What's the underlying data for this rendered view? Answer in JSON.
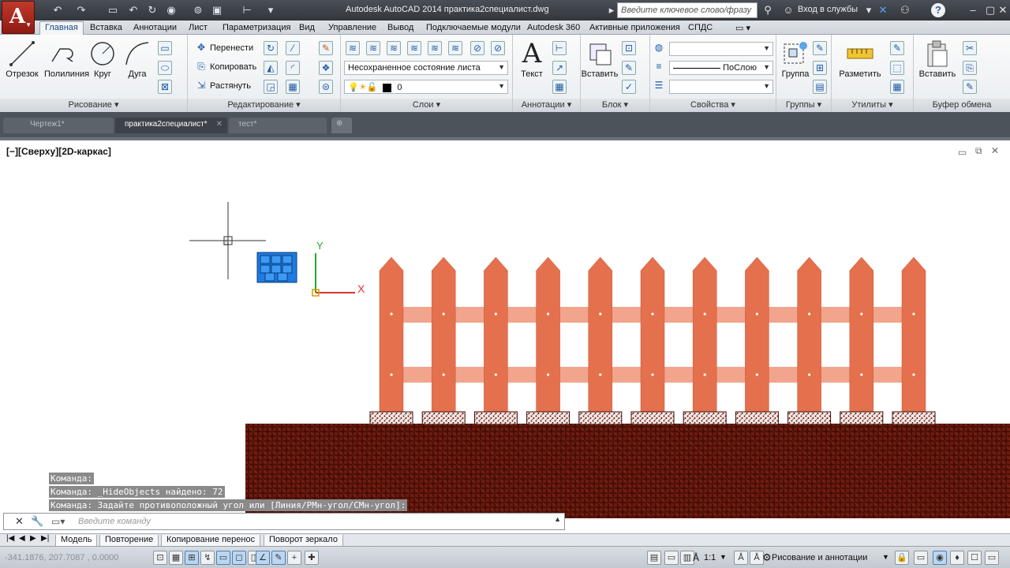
{
  "titlebar": {
    "app_logo": "A",
    "title": "Autodesk AutoCAD 2014     практика2специалист.dwg",
    "search_placeholder": "Введите ключевое слово/фразу",
    "login_label": "Вход в службы"
  },
  "ribbon_tabs": [
    "Главная",
    "Вставка",
    "Аннотации",
    "Лист",
    "Параметризация",
    "Вид",
    "Управление",
    "Вывод",
    "Подключаемые модули",
    "Autodesk 360",
    "Активные приложения",
    "СПДС"
  ],
  "ribbon": {
    "draw": {
      "title": "Рисование",
      "line": "Отрезок",
      "polyline": "Полилиния",
      "circle": "Круг",
      "arc": "Дуга"
    },
    "modify": {
      "title": "Редактирование",
      "move": "Перенести",
      "copy": "Копировать",
      "stretch": "Растянуть"
    },
    "layers": {
      "title": "Слои",
      "layer_state": "Несохраненное состояние листа",
      "current_layer": "0"
    },
    "annotations": {
      "title": "Аннотации",
      "text": "Текст"
    },
    "block": {
      "title": "Блок",
      "insert": "Вставить"
    },
    "properties": {
      "title": "Свойства",
      "lineweight": "ПоСлою"
    },
    "groups": {
      "title": "Группы",
      "group": "Группа"
    },
    "utilities": {
      "title": "Утилиты",
      "measure": "Разметить"
    },
    "clipboard": {
      "title": "Буфер обмена",
      "paste": "Вставить"
    }
  },
  "doc_tabs": [
    {
      "label": "Чертеж1*",
      "active": false
    },
    {
      "label": "практика2специалист*",
      "active": true
    },
    {
      "label": "тест*",
      "active": false
    }
  ],
  "viewport": {
    "label": "[−][Сверху][2D-каркас]",
    "ucs_x": "X",
    "ucs_y": "Y",
    "fence_pickets": 11,
    "colors": {
      "picket": "#e5704d",
      "rail": "#f1a58c",
      "ground": "#6b1a0e",
      "selection": "#1e7be0"
    }
  },
  "command": {
    "history": [
      "Команда:",
      "Команда: _HideObjects найдено: 72",
      "Команда: Задайте противоположный угол или [Линия/РМн-угол/СМн-угол]:"
    ],
    "input_placeholder": "Введите команду"
  },
  "layout_tabs": [
    "Модель",
    "Повторение",
    "Копирование перенос",
    "Поворот зеркало"
  ],
  "statusbar": {
    "coords": "-341.1876, 207.7087 , 0.0000",
    "scale": "1:1",
    "workspace": "Рисование и аннотации"
  }
}
